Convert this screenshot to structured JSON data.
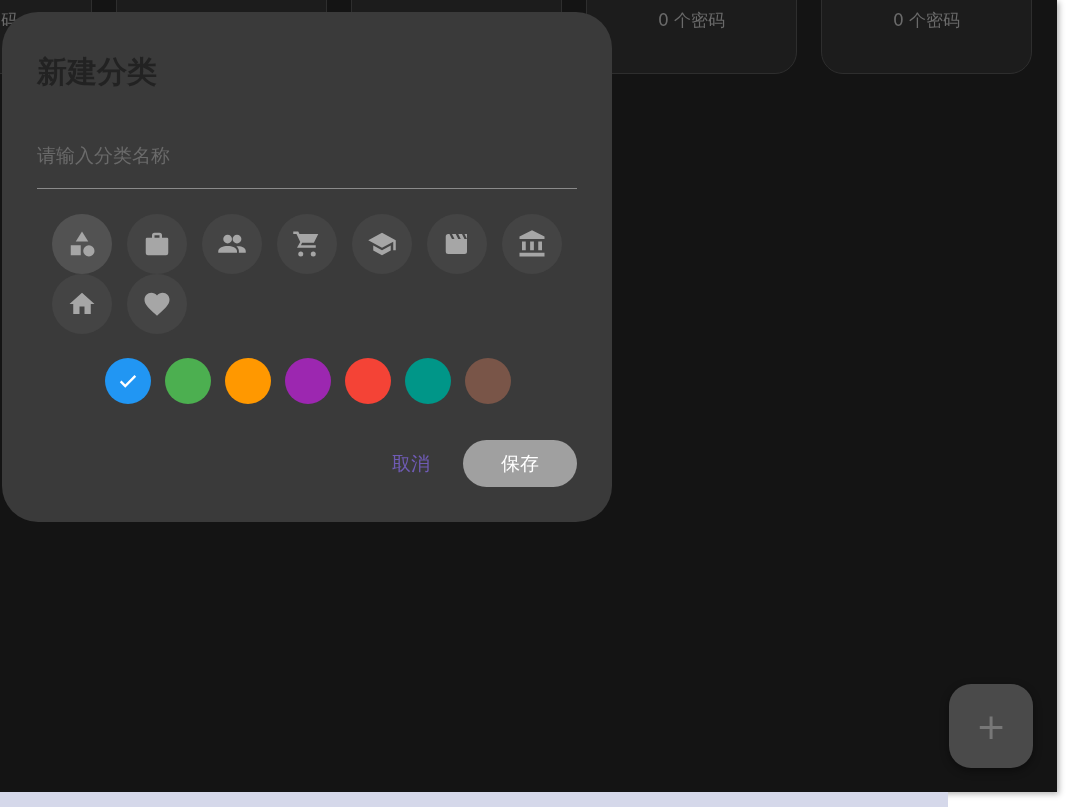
{
  "background_cards": [
    {
      "kind": "edge",
      "count": "码"
    },
    {
      "kind": "plain"
    },
    {
      "kind": "plain"
    },
    {
      "kind": "plain",
      "count": "0 个密码"
    },
    {
      "kind": "plain",
      "count": "0 个密码"
    }
  ],
  "dialog": {
    "title": "新建分类",
    "name_field": {
      "placeholder": "请输入分类名称"
    },
    "icons": [
      {
        "kind": "shapes",
        "selected": true
      },
      {
        "kind": "briefcase",
        "selected": false
      },
      {
        "kind": "people",
        "selected": false
      },
      {
        "kind": "cart",
        "selected": false
      },
      {
        "kind": "school",
        "selected": false
      },
      {
        "kind": "movie",
        "selected": false
      },
      {
        "kind": "bank",
        "selected": false
      },
      {
        "kind": "home",
        "selected": false
      },
      {
        "kind": "heart",
        "selected": false
      }
    ],
    "colors": [
      {
        "color": "#2196f3",
        "selected": true
      },
      {
        "color": "#4caf50",
        "selected": false
      },
      {
        "color": "#ff9800",
        "selected": false
      },
      {
        "color": "#9c27b0",
        "selected": false
      },
      {
        "color": "#f44336",
        "selected": false
      },
      {
        "color": "#009688",
        "selected": false
      },
      {
        "color": "#795548",
        "selected": false
      }
    ],
    "cancel": "取消",
    "save": "保存"
  },
  "fab": {
    "label": "+"
  }
}
